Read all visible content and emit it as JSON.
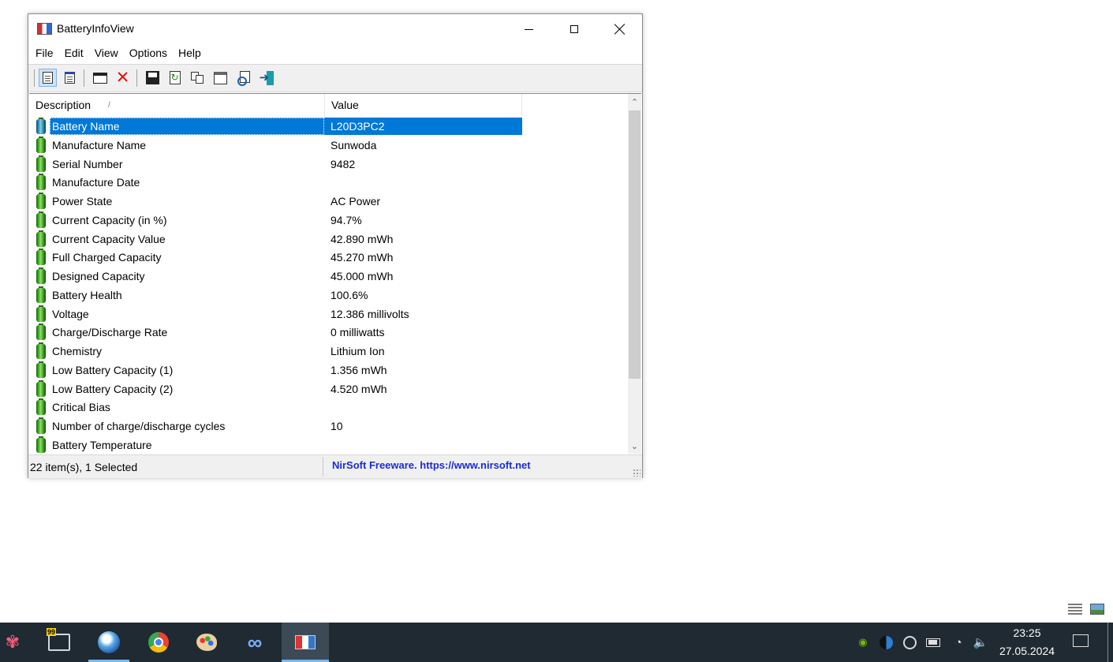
{
  "window": {
    "title": "BatteryInfoView",
    "menu": [
      "File",
      "Edit",
      "View",
      "Options",
      "Help"
    ],
    "toolbar_icons": [
      "details-view-icon",
      "html-report-icon",
      "window-icon",
      "delete-icon",
      "save-icon",
      "refresh-icon",
      "copy-icon",
      "properties-icon",
      "find-icon",
      "exit-icon"
    ]
  },
  "list": {
    "columns": [
      "Description",
      "Value"
    ],
    "sort_indicator": "/",
    "rows": [
      {
        "desc": "Battery Name",
        "value": "L20D3PC2",
        "selected": true
      },
      {
        "desc": "Manufacture Name",
        "value": "Sunwoda"
      },
      {
        "desc": "Serial Number",
        "value": "9482"
      },
      {
        "desc": "Manufacture Date",
        "value": ""
      },
      {
        "desc": "Power State",
        "value": "AC Power"
      },
      {
        "desc": "Current Capacity (in %)",
        "value": "94.7%"
      },
      {
        "desc": "Current Capacity Value",
        "value": "42.890 mWh"
      },
      {
        "desc": "Full Charged Capacity",
        "value": "45.270 mWh"
      },
      {
        "desc": "Designed Capacity",
        "value": "45.000 mWh"
      },
      {
        "desc": "Battery Health",
        "value": "100.6%"
      },
      {
        "desc": "Voltage",
        "value": "12.386 millivolts"
      },
      {
        "desc": "Charge/Discharge Rate",
        "value": "0 milliwatts"
      },
      {
        "desc": "Chemistry",
        "value": "Lithium Ion"
      },
      {
        "desc": "Low Battery Capacity (1)",
        "value": "1.356 mWh"
      },
      {
        "desc": "Low Battery Capacity (2)",
        "value": "4.520 mWh"
      },
      {
        "desc": "Critical Bias",
        "value": ""
      },
      {
        "desc": "Number of charge/discharge cycles",
        "value": "10"
      },
      {
        "desc": "Battery Temperature",
        "value": ""
      }
    ]
  },
  "status": {
    "items": "22 item(s), 1 Selected",
    "link": "NirSoft Freeware. https://www.nirsoft.net"
  },
  "taskbar": {
    "apps": [
      "paint-icon",
      "system-monitor-icon",
      "browser-ball-icon",
      "chrome-icon",
      "palette-icon",
      "infinity-icon",
      "batteryinfoview-icon"
    ],
    "monitor_badge": "99",
    "tray": [
      "nvidia-icon",
      "app-circle-icon",
      "steam-icon",
      "battery-icon",
      "wifi-icon",
      "volume-icon"
    ],
    "time": "23:25",
    "date": "27.05.2024"
  },
  "colors": {
    "selection": "#0078d7",
    "link": "#1a2bd8",
    "taskbar": "#1f2a33",
    "accent": "#76b9ed"
  }
}
